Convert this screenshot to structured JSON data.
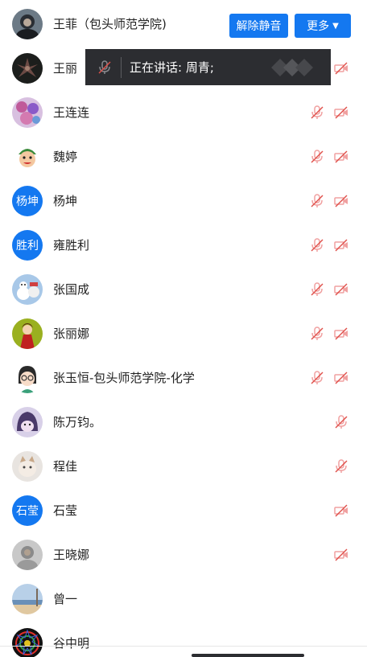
{
  "header_row": {
    "name": "王菲（包头师范学院)",
    "unmute_all_label": "解除静音",
    "more_label": "更多"
  },
  "toast": {
    "speaking_text": "正在讲话: 周青;"
  },
  "participants": [
    {
      "name": "王丽",
      "avatar": "dark-flower-avatar"
    },
    {
      "name": "王连连",
      "avatar": "purple-flower-avatar"
    },
    {
      "name": "魏婷",
      "avatar": "cartoon-avatar"
    },
    {
      "name": "杨坤",
      "avatar_text": "杨坤"
    },
    {
      "name": "雍胜利",
      "avatar_text": "胜利"
    },
    {
      "name": "张国成",
      "avatar": "snowman-avatar"
    },
    {
      "name": "张丽娜",
      "avatar": "girl-green-avatar"
    },
    {
      "name": "张玉恒-包头师范学院-化学",
      "avatar": "glasses-cartoon-avatar"
    },
    {
      "name": "陈万钧。",
      "avatar": "shark-avatar"
    },
    {
      "name": "程佳",
      "avatar": "cat-avatar"
    },
    {
      "name": "石莹",
      "avatar_text": "石莹"
    },
    {
      "name": "王晓娜",
      "avatar": "gray-photo-avatar"
    },
    {
      "name": "曾一",
      "avatar": "beach-avatar"
    },
    {
      "name": "谷中明",
      "avatar": "mandala-avatar"
    }
  ],
  "colors": {
    "accent": "#1478f0",
    "muted_icon": "#f0a0a0",
    "toast_bg": "#2c2d31"
  }
}
